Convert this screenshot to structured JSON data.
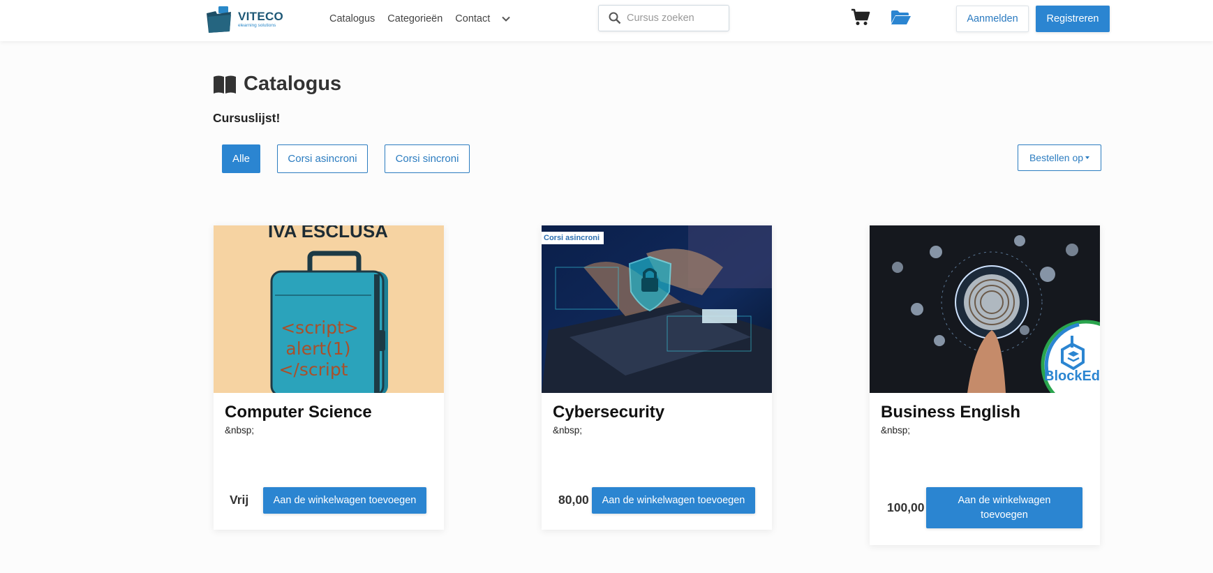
{
  "brand": {
    "name": "VITECO",
    "tagline": "elearning solutions"
  },
  "nav": {
    "items": [
      "Catalogus",
      "Categorieën",
      "Contact"
    ]
  },
  "search": {
    "placeholder": "Cursus zoeken"
  },
  "auth": {
    "login_label": "Aanmelden",
    "register_label": "Registreren"
  },
  "page": {
    "title": "Catalogus",
    "subtitle": "Cursuslijst!"
  },
  "filters": {
    "all": "Alle",
    "async": "Corsi asincroni",
    "sync": "Corsi sincroni",
    "sort_label": "Bestellen op"
  },
  "courses": [
    {
      "title": "Computer Science",
      "description": "&nbsp;",
      "price": "Vrij",
      "button": "Aan de winkelwagen toevoegen",
      "image_text": {
        "banner": "IVA ESCLUSA",
        "line1": "<script>",
        "line2": "alert(1)",
        "line3": "</script"
      }
    },
    {
      "title": "Cybersecurity",
      "description": "&nbsp;",
      "price": "80,00",
      "button": "Aan de winkelwagen toevoegen",
      "badge": "Corsi asincroni"
    },
    {
      "title": "Business English",
      "description": "&nbsp;",
      "price": "100,00",
      "button": "Aan de winkelwagen toevoegen",
      "image_text": {
        "logo": "BlockEd"
      }
    }
  ],
  "colors": {
    "primary": "#2b85d1",
    "brand_dark": "#1e5876"
  }
}
